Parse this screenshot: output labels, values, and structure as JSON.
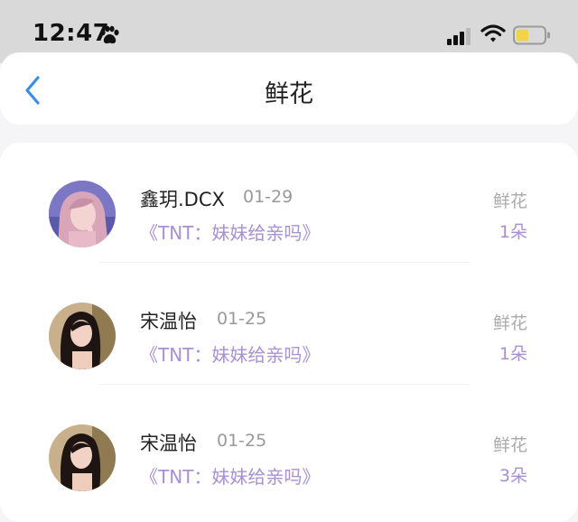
{
  "status_bar": {
    "time": "12:47"
  },
  "nav": {
    "title": "鲜花"
  },
  "records": [
    {
      "name": "鑫玥.DCX",
      "date": "01-29",
      "song": "《TNT：妹妹给亲吗》",
      "gift_type": "鲜花",
      "gift_count": "1朵",
      "avatar": "illustrated-girl"
    },
    {
      "name": "宋温怡",
      "date": "01-25",
      "song": "《TNT：妹妹给亲吗》",
      "gift_type": "鲜花",
      "gift_count": "1朵",
      "avatar": "portrait-photo"
    },
    {
      "name": "宋温怡",
      "date": "01-25",
      "song": "《TNT：妹妹给亲吗》",
      "gift_type": "鲜花",
      "gift_count": "3朵",
      "avatar": "portrait-photo"
    }
  ],
  "colors": {
    "accent_purple": "#a98fd4",
    "back_blue": "#3a8ee6",
    "battery_yellow": "#f3d34a"
  }
}
